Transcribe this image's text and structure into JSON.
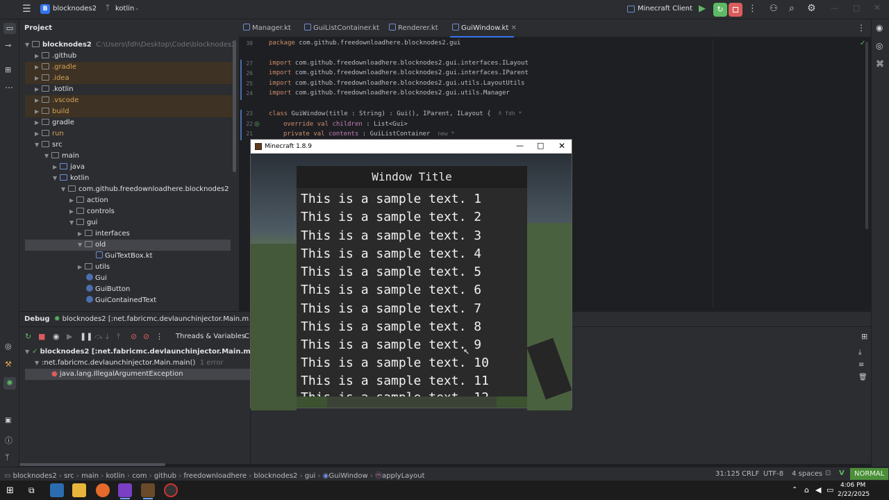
{
  "titlebar": {
    "project_badge": "B",
    "project_name": "blocknodes2",
    "branch": "kotlin",
    "run_config": "Minecraft Client"
  },
  "project_panel": {
    "title": "Project",
    "root_name": "blocknodes2",
    "root_path": "C:\\Users\\fdh\\Desktop\\Code\\blocknodes2",
    "items": [
      {
        "label": ".github"
      },
      {
        "label": ".gradle"
      },
      {
        "label": ".idea"
      },
      {
        "label": ".kotlin"
      },
      {
        "label": ".vscode"
      },
      {
        "label": "build"
      },
      {
        "label": "gradle"
      },
      {
        "label": "run"
      },
      {
        "label": "src"
      },
      {
        "label": "main"
      },
      {
        "label": "java"
      },
      {
        "label": "kotlin"
      },
      {
        "label": "com.github.freedownloadhere.blocknodes2"
      },
      {
        "label": "action"
      },
      {
        "label": "controls"
      },
      {
        "label": "gui"
      },
      {
        "label": "interfaces"
      },
      {
        "label": "old"
      },
      {
        "label": "GuiTextBox.kt"
      },
      {
        "label": "utils"
      },
      {
        "label": "Gui"
      },
      {
        "label": "GuiButton"
      },
      {
        "label": "GuiContainedText"
      }
    ]
  },
  "editor_tabs": [
    {
      "label": "Manager.kt"
    },
    {
      "label": "GuiListContainer.kt"
    },
    {
      "label": "Renderer.kt"
    },
    {
      "label": "GuiWindow.kt"
    }
  ],
  "code": {
    "line_numbers": [
      "30",
      "",
      "27",
      "26",
      "25",
      "24",
      "",
      "23",
      "22",
      "21",
      "20"
    ],
    "l1_kw": "package",
    "l1_rest": " com.github.freedownloadhere.blocknodes2.gui",
    "l2_kw": "import",
    "l2_rest": " com.github.freedownloadhere.blocknodes2.gui.interfaces.ILayout",
    "l3_kw": "import",
    "l3_rest": " com.github.freedownloadhere.blocknodes2.gui.interfaces.IParent",
    "l4_kw": "import",
    "l4_rest": " com.github.freedownloadhere.blocknodes2.gui.utils.LayoutUtils",
    "l5_kw": "import",
    "l5_rest": " com.github.freedownloadhere.blocknodes2.gui.utils.Manager",
    "l6_kw": "class",
    "l6_rest": " GuiWindow(title : String) : Gui(), IParent, ILayout {",
    "l6_hint": "≛ fdh *",
    "l7_kw": "override val",
    "l7_prop": " children",
    "l7_rest": " : List<Gui>",
    "l8_kw": "private val",
    "l8_prop": " contents",
    "l8_rest": " : GuiListContainer",
    "l8_hint": "new *"
  },
  "debug": {
    "tab": "Debug",
    "session": "blocknodes2 [:net.fabricmc.devlaunchinjector.Main.mai...",
    "threads_label": "Threads & Variables",
    "console_label": "C",
    "thread_main": "blocknodes2 [:net.fabricmc.devlaunchinjector.Main.main()]: Downloading",
    "frame": ":net.fabricmc.devlaunchinjector.Main.main()",
    "frame_hint": "1 error",
    "exception": "java.lang.IllegalArgumentException"
  },
  "minecraft": {
    "window_title": "Minecraft 1.8.9",
    "gui_title": "Window Title",
    "lines": [
      "This is a sample text. 1",
      "This is a sample text. 2",
      "This is a sample text. 3",
      "This is a sample text. 4",
      "This is a sample text. 5",
      "This is a sample text. 6",
      "This is a sample text. 7",
      "This is a sample text. 8",
      "This is a sample text. 9",
      "This is a sample text. 10",
      "This is a sample text. 11",
      "This is a sample text. 12"
    ]
  },
  "statusbar": {
    "crumbs": [
      "blocknodes2",
      "src",
      "main",
      "kotlin",
      "com",
      "github",
      "freedownloadhere",
      "blocknodes2",
      "gui",
      "GuiWindow",
      "applyLayout"
    ],
    "position": "31:125",
    "line_ending": "CRLF",
    "encoding": "UTF-8",
    "indent": "4 spaces",
    "mode": "NORMAL"
  },
  "taskbar": {
    "time": "4:06 PM",
    "date": "2/22/2025"
  },
  "colors": {
    "accent": "#3574f0",
    "run_green": "#5fb865",
    "stop_red": "#db5c5c",
    "mode_green": "#4c8f3a"
  }
}
